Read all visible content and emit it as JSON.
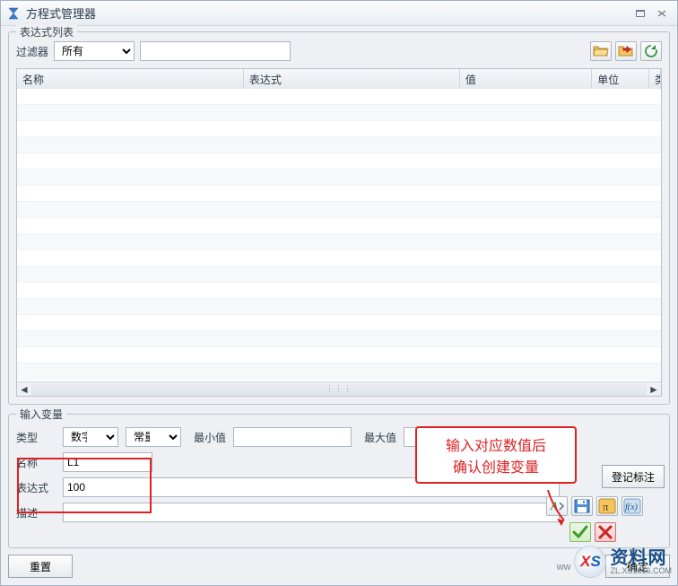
{
  "window": {
    "title": "方程式管理器"
  },
  "group_list": {
    "legend": "表达式列表"
  },
  "filter": {
    "label": "过滤器",
    "selected": "所有",
    "options": [
      "所有"
    ],
    "text": ""
  },
  "columns": {
    "name": "名称",
    "expression": "表达式",
    "value": "值",
    "unit": "单位",
    "type": "类"
  },
  "group_input": {
    "legend": "输入变量"
  },
  "input": {
    "type_label": "类型",
    "type_selected": "数字",
    "type_options": [
      "数字"
    ],
    "kind_selected": "常量",
    "kind_options": [
      "常量"
    ],
    "min_label": "最小值",
    "min_value": "",
    "max_label": "最大值",
    "max_value": "",
    "name_label": "名称",
    "name_value": "L1",
    "expr_label": "表达式",
    "expr_value": "100",
    "desc_label": "描述",
    "desc_value": "",
    "register_label": "登记标注"
  },
  "callout": {
    "line1": "输入对应数值后",
    "line2": "确认创建变量"
  },
  "buttons": {
    "reset": "重置",
    "ok": "确定"
  },
  "watermark": {
    "prefix": "ww",
    "logo_x": "X",
    "logo_s": "S",
    "main": "资料网",
    "sub": "ZL.XS1616.COM"
  }
}
